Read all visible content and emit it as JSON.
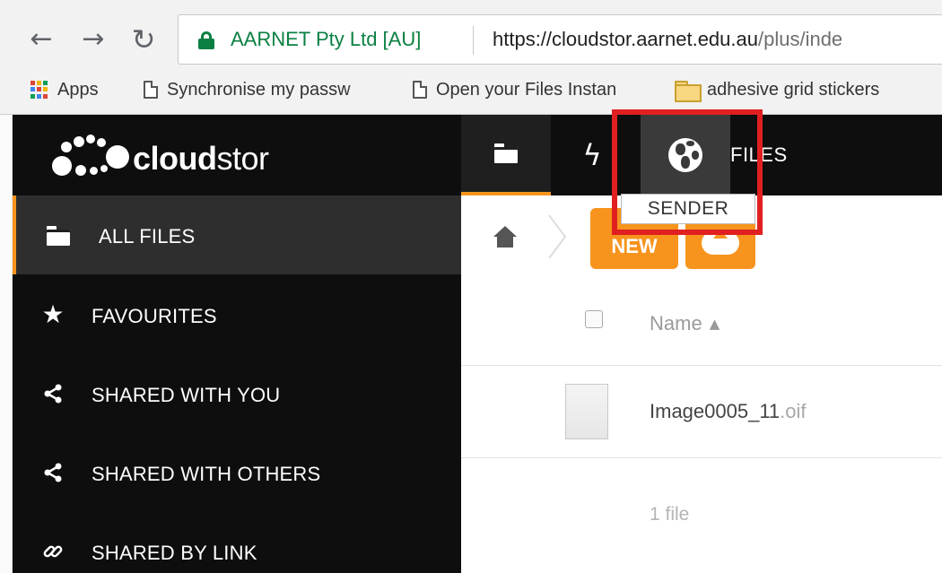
{
  "browser": {
    "ev_label": "AARNET Pty Ltd [AU]",
    "url_main": "https://cloudstor.aarnet.edu.au",
    "url_rest": "/plus/inde",
    "bookmarks": [
      {
        "label": "Apps",
        "icon": "apps-grid-icon"
      },
      {
        "label": "Synchronise my passw",
        "icon": "page-icon"
      },
      {
        "label": "Open your Files Instan",
        "icon": "page-icon"
      },
      {
        "label": "adhesive grid stickers",
        "icon": "folder-icon"
      }
    ]
  },
  "app": {
    "logo_bold": "cloud",
    "logo_light": "stor",
    "topnav": {
      "title": "FILES",
      "tooltip": "SENDER"
    },
    "sidebar": {
      "items": [
        {
          "label": "ALL FILES",
          "icon": "folder-icon",
          "active": true
        },
        {
          "label": "FAVOURITES",
          "icon": "star-icon"
        },
        {
          "label": "SHARED WITH YOU",
          "icon": "share-icon"
        },
        {
          "label": "SHARED WITH OTHERS",
          "icon": "share-icon"
        },
        {
          "label": "SHARED BY LINK",
          "icon": "link-icon"
        }
      ]
    },
    "toolbar": {
      "new_label": "NEW"
    },
    "table": {
      "name_header": "Name",
      "sort_arrow": "▲",
      "rows": [
        {
          "name": "Image0005_11",
          "ext": ".oif"
        }
      ],
      "summary": "1 file"
    }
  },
  "colors": {
    "accent": "#f7941d",
    "secure": "#0b8043",
    "highlight": "#e02020",
    "sidebar_bg": "#0e0e0e"
  }
}
